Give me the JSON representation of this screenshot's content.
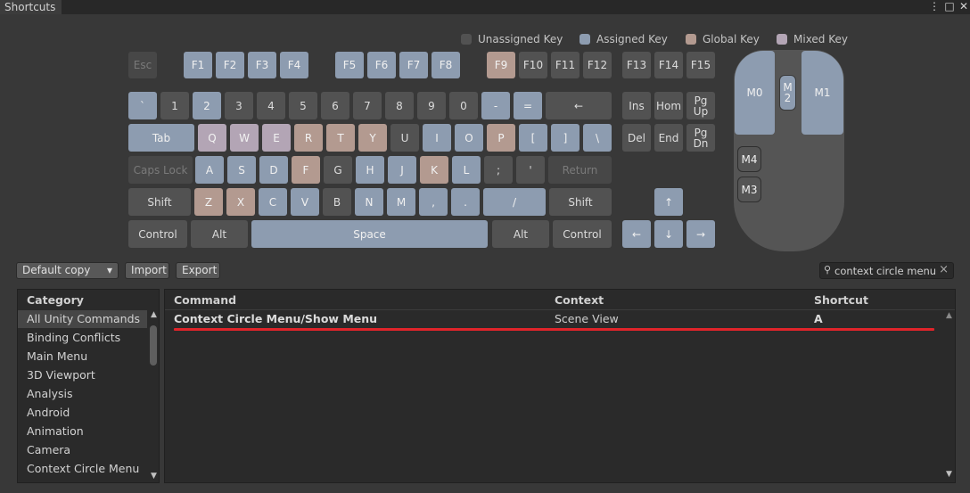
{
  "window": {
    "tab_title": "Shortcuts",
    "menu_icon": "⋮",
    "maximize_icon": "□",
    "close_icon": "✕"
  },
  "legend": {
    "unassigned": {
      "label": "Unassigned Key",
      "color": "#525252"
    },
    "assigned": {
      "label": "Assigned Key",
      "color": "#8d9cb0"
    },
    "global": {
      "label": "Global Key",
      "color": "#b39a90"
    },
    "mixed": {
      "label": "Mixed Key",
      "color": "#b3a5b5"
    }
  },
  "keyboard": {
    "rows": [
      {
        "keys": [
          {
            "label": "Esc",
            "state": "d"
          },
          {
            "label": "F1",
            "state": "a"
          },
          {
            "label": "F2",
            "state": "a"
          },
          {
            "label": "F3",
            "state": "a"
          },
          {
            "label": "F4",
            "state": "a"
          },
          {
            "label": "F5",
            "state": "a"
          },
          {
            "label": "F6",
            "state": "a"
          },
          {
            "label": "F7",
            "state": "a"
          },
          {
            "label": "F8",
            "state": "a"
          },
          {
            "label": "F9",
            "state": "g"
          },
          {
            "label": "F10",
            "state": "u"
          },
          {
            "label": "F11",
            "state": "u"
          },
          {
            "label": "F12",
            "state": "u"
          },
          {
            "label": "F13",
            "state": "u"
          },
          {
            "label": "F14",
            "state": "u"
          },
          {
            "label": "F15",
            "state": "u"
          }
        ]
      },
      {
        "keys": [
          {
            "label": "`",
            "state": "a"
          },
          {
            "label": "1",
            "state": "u"
          },
          {
            "label": "2",
            "state": "a"
          },
          {
            "label": "3",
            "state": "u"
          },
          {
            "label": "4",
            "state": "u"
          },
          {
            "label": "5",
            "state": "u"
          },
          {
            "label": "6",
            "state": "u"
          },
          {
            "label": "7",
            "state": "u"
          },
          {
            "label": "8",
            "state": "u"
          },
          {
            "label": "9",
            "state": "u"
          },
          {
            "label": "0",
            "state": "u"
          },
          {
            "label": "-",
            "state": "a"
          },
          {
            "label": "=",
            "state": "a"
          },
          {
            "label": "←",
            "state": "u"
          },
          {
            "label": "Ins",
            "state": "u"
          },
          {
            "label": "Hom",
            "state": "u"
          },
          {
            "label": "Pg Up",
            "state": "u"
          }
        ]
      },
      {
        "keys": [
          {
            "label": "Tab",
            "state": "a"
          },
          {
            "label": "Q",
            "state": "m"
          },
          {
            "label": "W",
            "state": "m"
          },
          {
            "label": "E",
            "state": "m"
          },
          {
            "label": "R",
            "state": "g"
          },
          {
            "label": "T",
            "state": "g"
          },
          {
            "label": "Y",
            "state": "g"
          },
          {
            "label": "U",
            "state": "u"
          },
          {
            "label": "I",
            "state": "a"
          },
          {
            "label": "O",
            "state": "a"
          },
          {
            "label": "P",
            "state": "g"
          },
          {
            "label": "[",
            "state": "a"
          },
          {
            "label": "]",
            "state": "a"
          },
          {
            "label": "\\",
            "state": "a"
          },
          {
            "label": "Del",
            "state": "u"
          },
          {
            "label": "End",
            "state": "u"
          },
          {
            "label": "Pg Dn",
            "state": "u"
          }
        ]
      },
      {
        "keys": [
          {
            "label": "Caps Lock",
            "state": "d"
          },
          {
            "label": "A",
            "state": "a"
          },
          {
            "label": "S",
            "state": "a"
          },
          {
            "label": "D",
            "state": "a"
          },
          {
            "label": "F",
            "state": "g"
          },
          {
            "label": "G",
            "state": "u"
          },
          {
            "label": "H",
            "state": "a"
          },
          {
            "label": "J",
            "state": "a"
          },
          {
            "label": "K",
            "state": "g"
          },
          {
            "label": "L",
            "state": "a"
          },
          {
            "label": ";",
            "state": "u"
          },
          {
            "label": "'",
            "state": "u"
          },
          {
            "label": "Return",
            "state": "d"
          }
        ]
      },
      {
        "keys": [
          {
            "label": "Shift",
            "state": "u"
          },
          {
            "label": "Z",
            "state": "g"
          },
          {
            "label": "X",
            "state": "g"
          },
          {
            "label": "C",
            "state": "a"
          },
          {
            "label": "V",
            "state": "a"
          },
          {
            "label": "B",
            "state": "u"
          },
          {
            "label": "N",
            "state": "a"
          },
          {
            "label": "M",
            "state": "a"
          },
          {
            "label": ",",
            "state": "a"
          },
          {
            "label": ".",
            "state": "a"
          },
          {
            "label": "/",
            "state": "a"
          },
          {
            "label": "Shift",
            "state": "u"
          },
          {
            "label": "↑",
            "state": "a"
          }
        ]
      },
      {
        "keys": [
          {
            "label": "Control",
            "state": "u"
          },
          {
            "label": "Alt",
            "state": "u"
          },
          {
            "label": "Space",
            "state": "a"
          },
          {
            "label": "Alt",
            "state": "u"
          },
          {
            "label": "Control",
            "state": "u"
          },
          {
            "label": "←",
            "state": "a"
          },
          {
            "label": "↓",
            "state": "a"
          },
          {
            "label": "→",
            "state": "a"
          }
        ]
      }
    ]
  },
  "mouse": {
    "buttons": [
      {
        "label": "M0",
        "state": "a"
      },
      {
        "label": "M 2",
        "state": "a"
      },
      {
        "label": "M1",
        "state": "a"
      },
      {
        "label": "M4",
        "state": "u"
      },
      {
        "label": "M3",
        "state": "u"
      }
    ]
  },
  "toolbar": {
    "profile": "Default copy",
    "dropdown_icon": "▾",
    "import_label": "Import",
    "export_label": "Export",
    "search_value": "context circle menu",
    "search_icon": "⚲",
    "clear_icon": "×"
  },
  "categories": {
    "header": "Category",
    "items": [
      "All Unity Commands",
      "Binding Conflicts",
      "Main Menu",
      "3D Viewport",
      "Analysis",
      "Android",
      "Animation",
      "Camera",
      "Context Circle Menu"
    ],
    "selected_index": 0
  },
  "commands": {
    "headers": {
      "command": "Command",
      "context": "Context",
      "shortcut": "Shortcut"
    },
    "rows": [
      {
        "command": "Context Circle Menu/Show Menu",
        "context": "Scene View",
        "shortcut": "A"
      }
    ],
    "highlight_color": "#e0242a"
  }
}
